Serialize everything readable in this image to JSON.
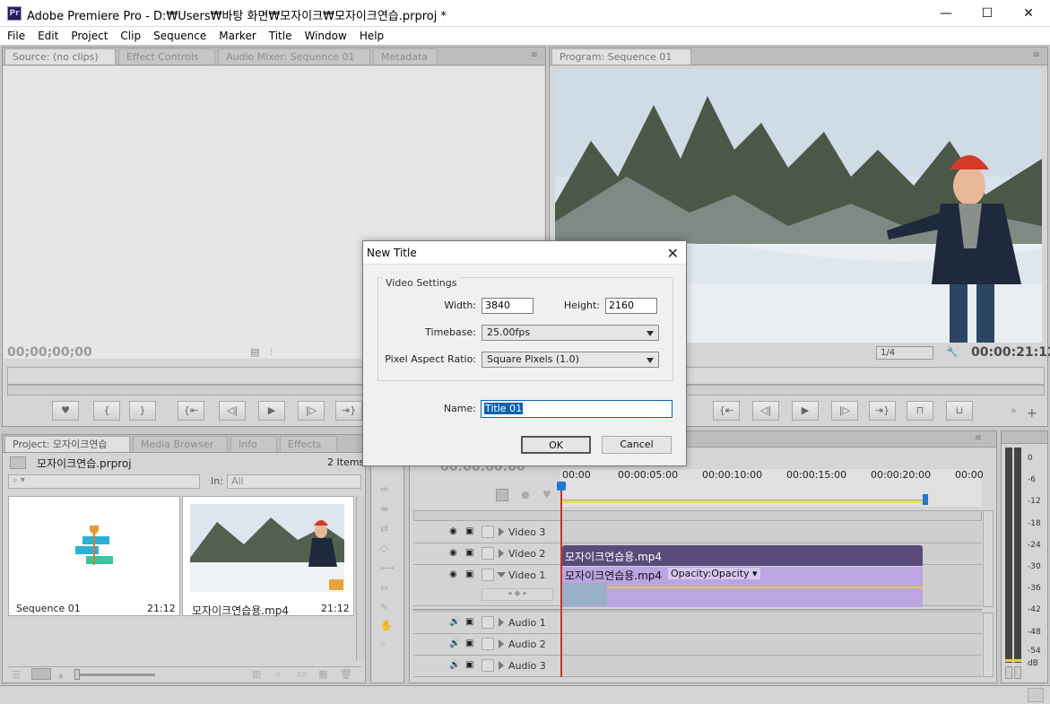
{
  "app": {
    "icon_label": "Pr",
    "title": "Adobe Premiere Pro - D:₩Users₩바탕 화면₩모자이크₩모자이크연습.prproj *",
    "minimize": "—",
    "maximize": "☐",
    "close": "✕"
  },
  "menu": [
    "File",
    "Edit",
    "Project",
    "Clip",
    "Sequence",
    "Marker",
    "Title",
    "Window",
    "Help"
  ],
  "source_panel": {
    "tabs": [
      "Source: (no clips)",
      "Effect Controls",
      "Audio Mixer: Sequence 01",
      "Metadata"
    ],
    "timecode": "00;00;00;00"
  },
  "program_panel": {
    "tab": "Program: Sequence 01",
    "zoom": "1/4",
    "timecode": "00:00:21:12"
  },
  "project_panel": {
    "tabs": [
      "Project: 모자이크연습",
      "Media Browser",
      "Info",
      "Effects"
    ],
    "project_file": "모자이크연습.prproj",
    "item_count": "2 Items",
    "in_label": "In:",
    "in_value": "All",
    "items": [
      {
        "name": "Sequence 01",
        "duration": "21:12"
      },
      {
        "name": "모자이크연습용.mp4",
        "duration": "21:12"
      }
    ]
  },
  "timeline": {
    "timecode": "00:00:00:00",
    "ruler": [
      "00:00",
      "00:00:05:00",
      "00:00:10:00",
      "00:00:15:00",
      "00:00:20:00",
      "00:00"
    ],
    "tracks": [
      "Video 3",
      "Video 2",
      "Video 1",
      "Audio 1",
      "Audio 2",
      "Audio 3"
    ],
    "clip_v2": "모자이크연습용.mp4",
    "clip_v1": "모자이크연습용.mp4",
    "clip_v1_fx": "Opacity:Opacity"
  },
  "audio_meter": {
    "labels": [
      "0",
      "-6",
      "-12",
      "-18",
      "-24",
      "-30",
      "-36",
      "-42",
      "-48",
      "-54",
      "dB"
    ]
  },
  "dialog": {
    "title": "New Title",
    "group": "Video Settings",
    "width_label": "Width:",
    "width_value": "3840",
    "height_label": "Height:",
    "height_value": "2160",
    "timebase_label": "Timebase:",
    "timebase_value": "25.00fps",
    "par_label": "Pixel Aspect Ratio:",
    "par_value": "Square Pixels (1.0)",
    "name_label": "Name:",
    "name_value": "Title 01",
    "ok": "OK",
    "cancel": "Cancel"
  },
  "colors": {
    "clip_v2": "#5b4b7a",
    "clip_v1": "#bba6e3",
    "playhead": "#c0392b",
    "accent": "#0a64ad"
  }
}
